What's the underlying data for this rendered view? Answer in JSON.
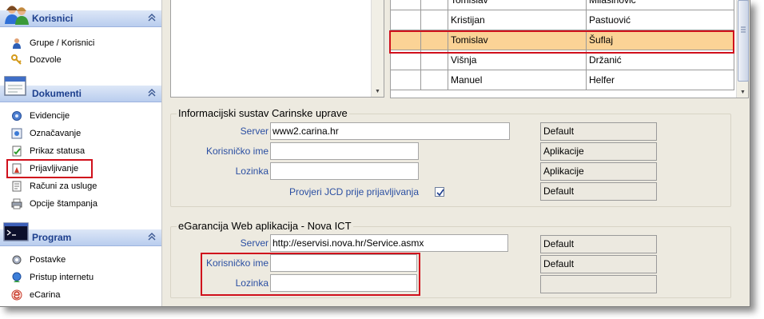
{
  "sidebar": {
    "sections": [
      {
        "title": "Korisnici",
        "items": [
          {
            "label": "Grupe / Korisnici"
          },
          {
            "label": "Dozvole"
          }
        ]
      },
      {
        "title": "Dokumenti",
        "items": [
          {
            "label": "Evidencije"
          },
          {
            "label": "Označavanje"
          },
          {
            "label": "Prikaz statusa"
          },
          {
            "label": "Prijavljivanje"
          },
          {
            "label": "Računi za usluge"
          },
          {
            "label": "Opcije štampanja"
          }
        ]
      },
      {
        "title": "Program",
        "items": [
          {
            "label": "Postavke"
          },
          {
            "label": "Pristup internetu"
          },
          {
            "label": "eCarina"
          }
        ]
      }
    ],
    "collapse_glyph": "«"
  },
  "users_grid": {
    "rows": [
      {
        "first": "Tomislav",
        "last": "Milašinović",
        "selected": false
      },
      {
        "first": "Kristijan",
        "last": "Pastuović",
        "selected": false
      },
      {
        "first": "Tomislav",
        "last": "Šuflaj",
        "selected": true
      },
      {
        "first": "Višnja",
        "last": "Držanić",
        "selected": false
      },
      {
        "first": "Manuel",
        "last": "Helfer",
        "selected": false
      }
    ]
  },
  "cis_group": {
    "title": "Informacijski sustav Carinske uprave",
    "server_label": "Server",
    "server_value": "www2.carina.hr",
    "server_source": "Default",
    "user_label": "Korisničko ime",
    "user_value": "",
    "user_source": "Aplikacije",
    "password_label": "Lozinka",
    "password_value": "",
    "password_source": "Aplikacije",
    "check_label": "Provjeri JCD prije prijavljivanja",
    "check_checked": true,
    "check_source": "Default"
  },
  "eg_group": {
    "title": "eGarancija Web aplikacija - Nova ICT",
    "server_label": "Server",
    "server_value": "http://eservisi.nova.hr/Service.asmx",
    "server_source": "Default",
    "user_label": "Korisničko ime",
    "user_value": "",
    "user_source": "Default",
    "password_label": "Lozinka",
    "password_value": "",
    "password_source": ""
  },
  "colors": {
    "accent_highlight": "#d0101c",
    "selected_row": "#fbd396",
    "section_title": "#1d3f8d",
    "field_label": "#2b4fa2"
  }
}
